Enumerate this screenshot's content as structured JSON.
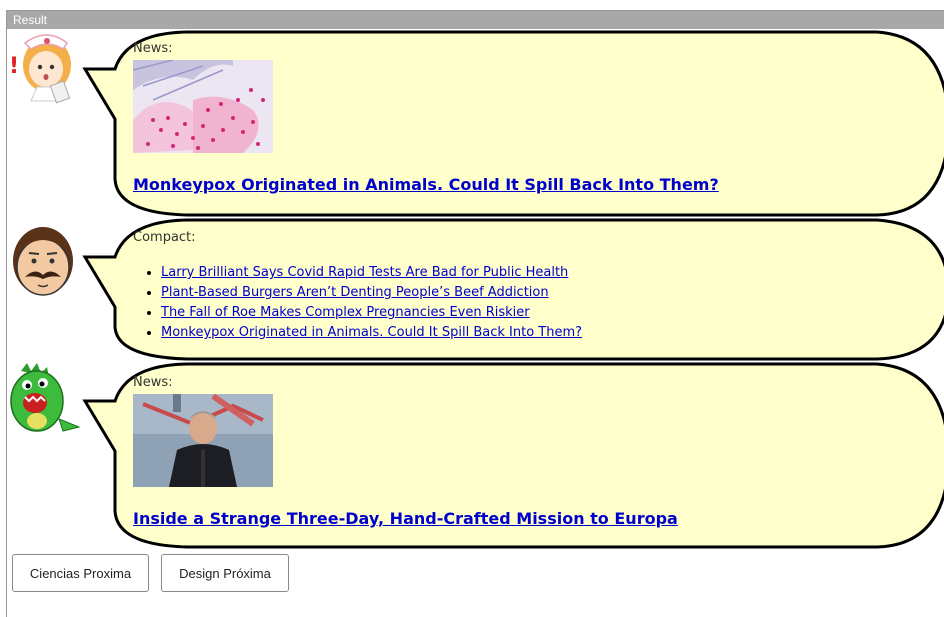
{
  "window": {
    "title": "Result"
  },
  "posts": [
    {
      "speaker": "nurse-avatar",
      "label": "News:",
      "image": "monkeypox-microscopy-thumbnail",
      "headline": "Monkeypox Originated in Animals. Could It Spill Back Into Them?"
    },
    {
      "speaker": "mustache-man-avatar",
      "label": "Compact:",
      "links": [
        "Larry Brilliant Says Covid Rapid Tests Are Bad for Public Health",
        "Plant-Based Burgers Aren’t Denting People’s Beef Addiction",
        "The Fall of Roe Makes Complex Pregnancies Even Riskier",
        "Monkeypox Originated in Animals. Could It Spill Back Into Them?"
      ]
    },
    {
      "speaker": "green-dinosaur-avatar",
      "label": "News:",
      "image": "man-on-helipad-thumbnail",
      "headline": "Inside a Strange Three-Day, Hand-Crafted Mission to Europa"
    }
  ],
  "buttons": {
    "ciencias": "Ciencias Proxima",
    "design": "Design Próxima"
  },
  "colors": {
    "bubble_fill": "#ffffcc",
    "bubble_stroke": "#000000",
    "link": "#0000cc"
  }
}
